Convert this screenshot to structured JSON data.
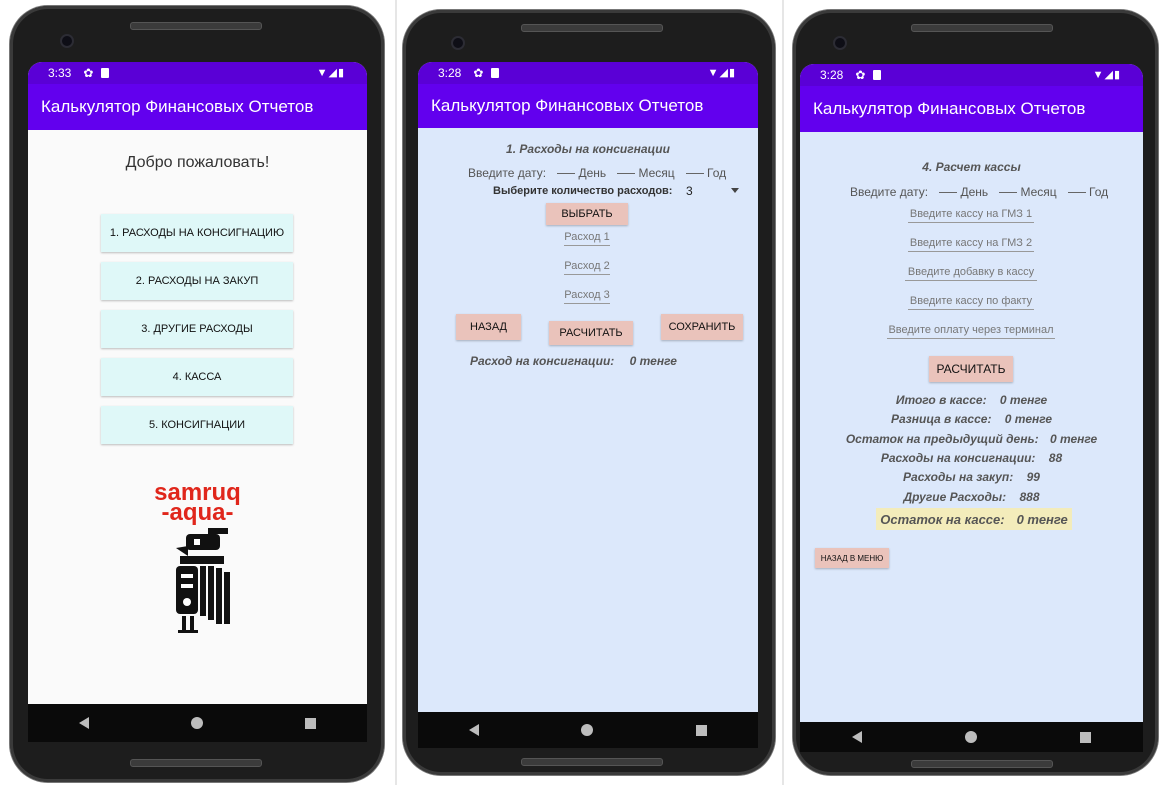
{
  "common": {
    "app_title": "Калькулятор Финансовых Отчетов"
  },
  "screen1": {
    "status_time": "3:33",
    "welcome": "Добро пожаловать!",
    "menu": [
      "1. РАСХОДЫ НА КОНСИГНАЦИЮ",
      "2. РАСХОДЫ НА ЗАКУП",
      "3. ДРУГИЕ РАСХОДЫ",
      "4. КАССА",
      "5. КОНСИГНАЦИИ"
    ],
    "logo_line1": "samruq",
    "logo_line2": "-aqua-"
  },
  "screen2": {
    "status_time": "3:28",
    "title": "1. Расходы на консигнации",
    "date_prompt": "Введите дату:",
    "day": "День",
    "month": "Месяц",
    "year": "Год",
    "count_label": "Выберите количество расходов:",
    "count_value": "3",
    "select_button": "ВЫБРАТЬ",
    "fields": [
      "Расход 1",
      "Расход 2",
      "Расход 3"
    ],
    "back_button": "НАЗАД",
    "calc_button": "РАСЧИТАТЬ",
    "save_button": "СОХРАНИТЬ",
    "result_label": "Расход на консигнации:",
    "result_value": "0 тенге"
  },
  "screen3": {
    "status_time": "3:28",
    "title": "4. Расчет кассы",
    "date_prompt": "Введите дату:",
    "day": "День",
    "month": "Месяц",
    "year": "Год",
    "fields": [
      "Введите кассу на ГМЗ 1",
      "Введите кассу на ГМЗ 2",
      "Введите добавку в кассу",
      "Введите кассу по факту",
      "Введите оплату через терминал"
    ],
    "calc_button": "РАСЧИТАТЬ",
    "results": [
      {
        "label": "Итого в кассе:",
        "value": "0 тенге"
      },
      {
        "label": "Разница в кассе:",
        "value": "0 тенге"
      },
      {
        "label": "Остаток на предыдущий день:",
        "value": "0 тенге"
      },
      {
        "label": "Расходы на консигнации:",
        "value": "88"
      },
      {
        "label": "Расходы на закуп:",
        "value": "99"
      },
      {
        "label": "Другие Расходы:",
        "value": "888"
      }
    ],
    "highlight_label": "Остаток на кассе:",
    "highlight_value": "0 тенге",
    "back_menu_button": "НАЗАД В МЕНЮ"
  },
  "colors": {
    "appbar": "#6200ee",
    "statusbar": "#5a00d6",
    "content_bg_form": "#dce8fb",
    "menu_button": "#dff8f8",
    "action_button": "#eac3bb",
    "highlight": "#f3ecbb",
    "logo_red": "#e0261b"
  }
}
